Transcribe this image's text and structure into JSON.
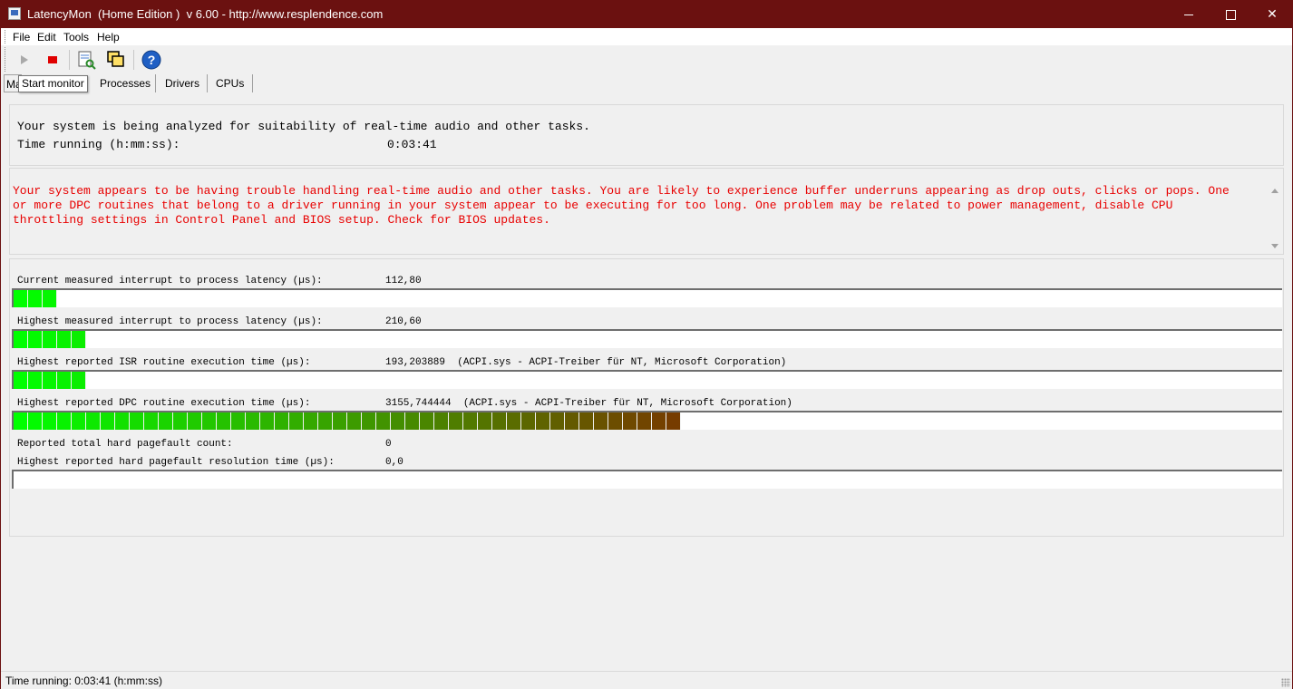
{
  "window": {
    "title": "LatencyMon  (Home Edition )  v 6.00 - http://www.resplendence.com"
  },
  "menu": [
    "File",
    "Edit",
    "Tools",
    "Help"
  ],
  "toolbar": {
    "icons": [
      "play-icon",
      "stop-icon",
      "report-icon",
      "windows-icon",
      "help-icon"
    ],
    "tooltip": "Start monitor"
  },
  "tabs": [
    "Ma",
    "Processes",
    "Drivers",
    "CPUs"
  ],
  "summary": {
    "analysis_text": "Your system is being analyzed for suitability of real-time audio and other tasks.",
    "time_label": "Time running (h:mm:ss):",
    "time_value": "0:03:41"
  },
  "warning": {
    "text": "Your system appears to be having trouble handling real-time audio and other tasks. You are likely to experience buffer underruns appearing as drop outs, clicks or pops. One\nor more DPC routines that belong to a driver running in your system appear to be executing for too long. One problem may be related to power management, disable CPU\nthrottling settings in Control Panel and BIOS setup. Check for BIOS updates.",
    "color": "#e80000"
  },
  "metrics": [
    {
      "label": "Current measured interrupt to process latency (µs):",
      "value": "112,80",
      "segments": 3
    },
    {
      "label": "Highest measured interrupt to process latency (µs):",
      "value": "210,60",
      "segments": 5
    },
    {
      "label": "Highest reported ISR routine execution time (µs):",
      "value": "193,203889  (ACPI.sys - ACPI-Treiber für NT, Microsoft Corporation)",
      "segments": 5
    },
    {
      "label": "Highest reported DPC routine execution time (µs):",
      "value": "3155,744444  (ACPI.sys - ACPI-Treiber für NT, Microsoft Corporation)",
      "segments": 46
    },
    {
      "label": "Reported total hard pagefault count:",
      "value": "0"
    },
    {
      "label": "Highest reported hard pagefault resolution time (µs):",
      "value": "0,0",
      "segments": 0
    }
  ],
  "colors": {
    "bar_start": "#00ff00",
    "bar_end": "#8b1a00",
    "titlebar": "#6b1110"
  },
  "status": {
    "text": "Time running: 0:03:41  (h:mm:ss)"
  }
}
